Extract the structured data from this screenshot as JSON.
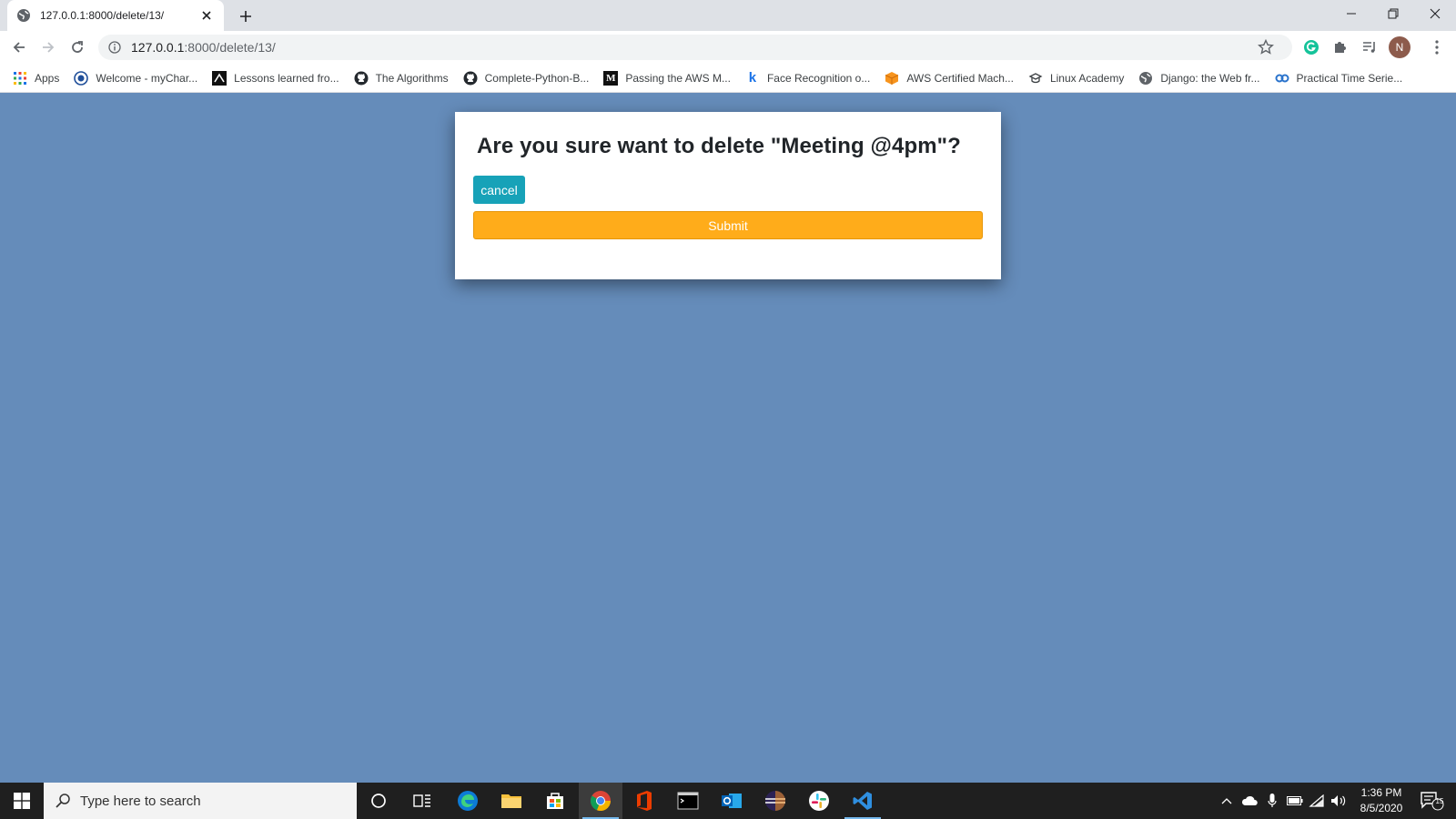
{
  "browser": {
    "tab_title": "127.0.0.1:8000/delete/13/",
    "url_host": "127.0.0.1",
    "url_rest": ":8000/delete/13/",
    "profile_initial": "N",
    "bookmarks": [
      {
        "label": "Apps",
        "icon": "apps-grid-icon"
      },
      {
        "label": "Welcome - myChar...",
        "icon": "mychart-icon"
      },
      {
        "label": "Lessons learned fro...",
        "icon": "lessons-icon"
      },
      {
        "label": "The Algorithms",
        "icon": "github-icon"
      },
      {
        "label": "Complete-Python-B...",
        "icon": "github-icon"
      },
      {
        "label": "Passing the AWS M...",
        "icon": "medium-icon"
      },
      {
        "label": "Face Recognition o...",
        "icon": "k-icon"
      },
      {
        "label": "AWS Certified Mach...",
        "icon": "aws-box-icon"
      },
      {
        "label": "Linux Academy",
        "icon": "linux-academy-icon"
      },
      {
        "label": "Django: the Web fr...",
        "icon": "globe-icon"
      },
      {
        "label": "Practical Time Serie...",
        "icon": "coursera-icon"
      }
    ]
  },
  "dialog": {
    "heading": "Are you sure want to delete \"Meeting @4pm\"?",
    "cancel_label": "cancel",
    "submit_label": "Submit"
  },
  "colors": {
    "page_bg": "#658cba",
    "cancel_bg": "#17a2b8",
    "submit_bg": "#ffac1a"
  },
  "taskbar": {
    "search_placeholder": "Type here to search",
    "time": "1:36 PM",
    "date": "8/5/2020",
    "notification_count": "15"
  }
}
